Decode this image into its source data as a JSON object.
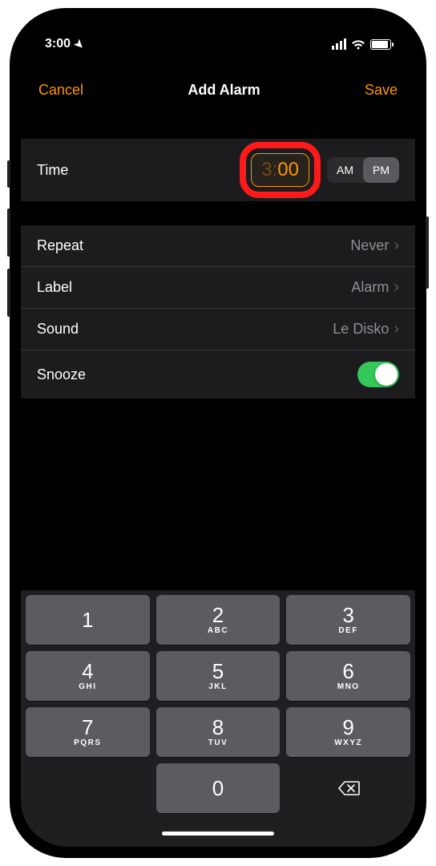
{
  "status": {
    "time": "3:00",
    "location_icon": "location-arrow"
  },
  "nav": {
    "cancel": "Cancel",
    "title": "Add Alarm",
    "save": "Save"
  },
  "time_section": {
    "label": "Time",
    "hour": "3",
    "minute": "00",
    "am": "AM",
    "pm": "PM",
    "selected_period": "PM"
  },
  "settings": {
    "repeat": {
      "label": "Repeat",
      "value": "Never"
    },
    "label_row": {
      "label": "Label",
      "value": "Alarm"
    },
    "sound": {
      "label": "Sound",
      "value": "Le Disko"
    },
    "snooze": {
      "label": "Snooze",
      "enabled": true
    }
  },
  "keypad": {
    "keys": [
      {
        "num": "1",
        "letters": ""
      },
      {
        "num": "2",
        "letters": "ABC"
      },
      {
        "num": "3",
        "letters": "DEF"
      },
      {
        "num": "4",
        "letters": "GHI"
      },
      {
        "num": "5",
        "letters": "JKL"
      },
      {
        "num": "6",
        "letters": "MNO"
      },
      {
        "num": "7",
        "letters": "PQRS"
      },
      {
        "num": "8",
        "letters": "TUV"
      },
      {
        "num": "9",
        "letters": "WXYZ"
      },
      {
        "num": "0",
        "letters": ""
      }
    ]
  },
  "colors": {
    "accent": "#ff9500",
    "toggle_on": "#34c759",
    "highlight": "#ff1a1a"
  }
}
